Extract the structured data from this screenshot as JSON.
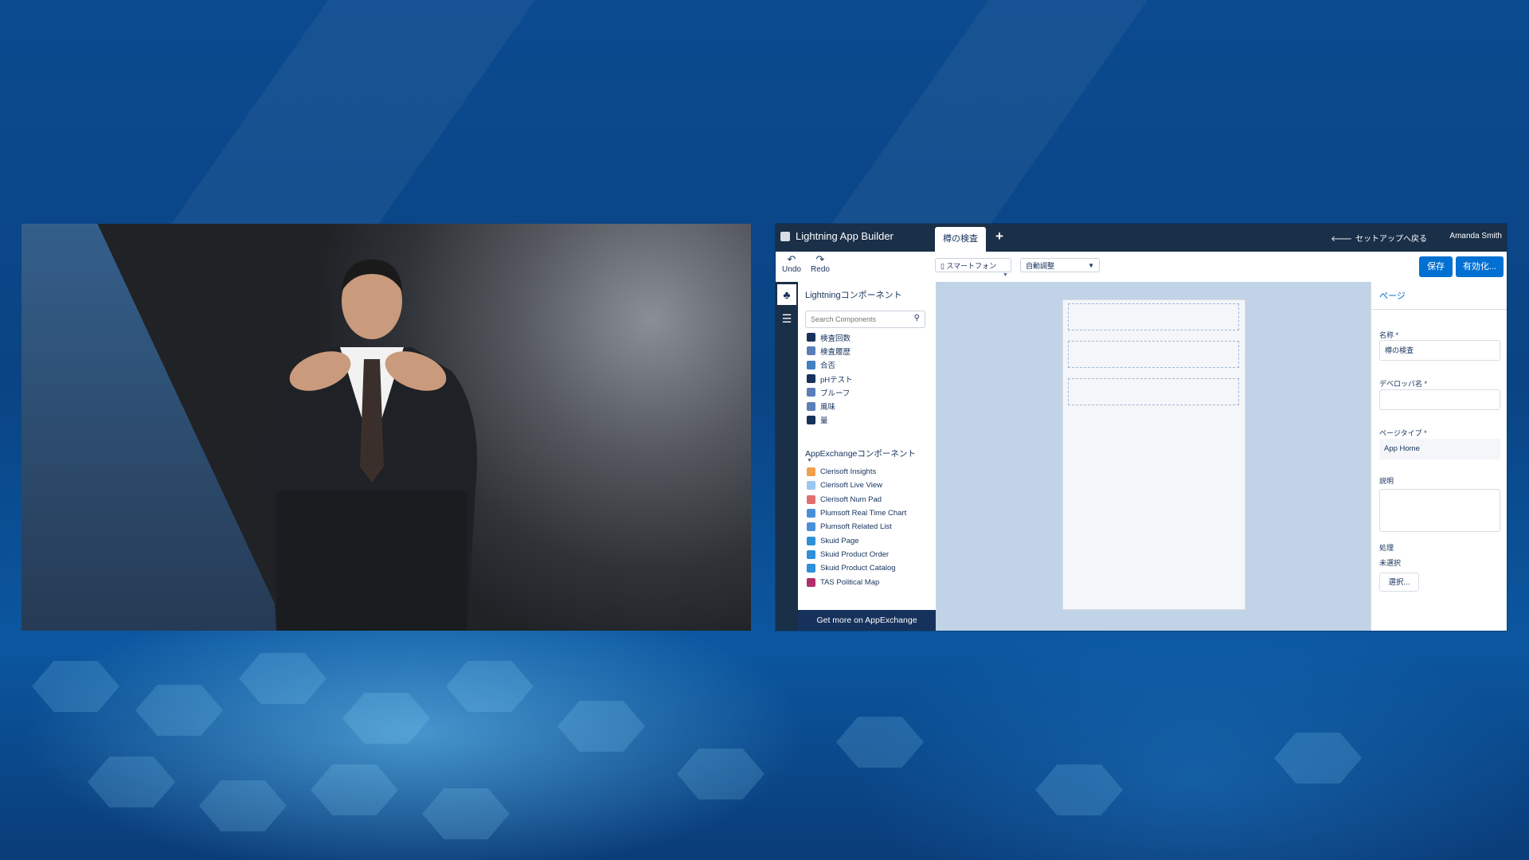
{
  "app": {
    "title": "Lightning App Builder",
    "tabs": [
      {
        "label": "樽の検査"
      }
    ],
    "add_tab": "+",
    "back_link": "セットアップへ戻る",
    "user_name": "Amanda Smith"
  },
  "toolbar": {
    "undo_label": "Undo",
    "redo_label": "Redo",
    "device_select": "スマートフォン",
    "zoom_select": "自動調整",
    "save_label": "保存",
    "activate_label": "有効化..."
  },
  "palette": {
    "title": "Lightningコンポーネント",
    "search_placeholder": "Search Components",
    "lightning_components": [
      {
        "label": "検査回数",
        "color": "#16325c"
      },
      {
        "label": "検査履歴",
        "color": "#5a7fb8"
      },
      {
        "label": "合否",
        "color": "#3f7fc2"
      },
      {
        "label": "pHテスト",
        "color": "#16325c"
      },
      {
        "label": "ブルーフ",
        "color": "#5a7fb8"
      },
      {
        "label": "風味",
        "color": "#5a7fb8"
      },
      {
        "label": "量",
        "color": "#16325c"
      }
    ],
    "appexchange_title": "AppExchangeコンポーネント",
    "appexchange_components": [
      {
        "label": "Clerisoft Insights",
        "color": "#f0a04b"
      },
      {
        "label": "Clerisoft Live View",
        "color": "#9ac7ef"
      },
      {
        "label": "Clerisoft Num Pad",
        "color": "#e07070"
      },
      {
        "label": "Plumsoft Real Time Chart",
        "color": "#4a90d9"
      },
      {
        "label": "Plumsoft Related List",
        "color": "#4a90d9"
      },
      {
        "label": "Skuid Page",
        "color": "#2f8fd8"
      },
      {
        "label": "Skuid Product Order",
        "color": "#2f8fd8"
      },
      {
        "label": "Skuid Product Catalog",
        "color": "#2f8fd8"
      },
      {
        "label": "TAS Political Map",
        "color": "#b0306a"
      }
    ],
    "appexchange_link": "Get more on AppExchange"
  },
  "properties": {
    "header": "ページ",
    "name_label": "名称 *",
    "name_value": "樽の検査",
    "developer_name_label": "デベロッパ名 *",
    "developer_name_value": "",
    "page_type_label": "ページタイプ *",
    "page_type_value": "App Home",
    "description_label": "説明",
    "action_label": "処理",
    "action_value": "未選択",
    "select_button": "選択..."
  },
  "colors": {
    "accent": "#0070d2",
    "header": "#1a2f48",
    "canvas": "#c1d3e6"
  }
}
